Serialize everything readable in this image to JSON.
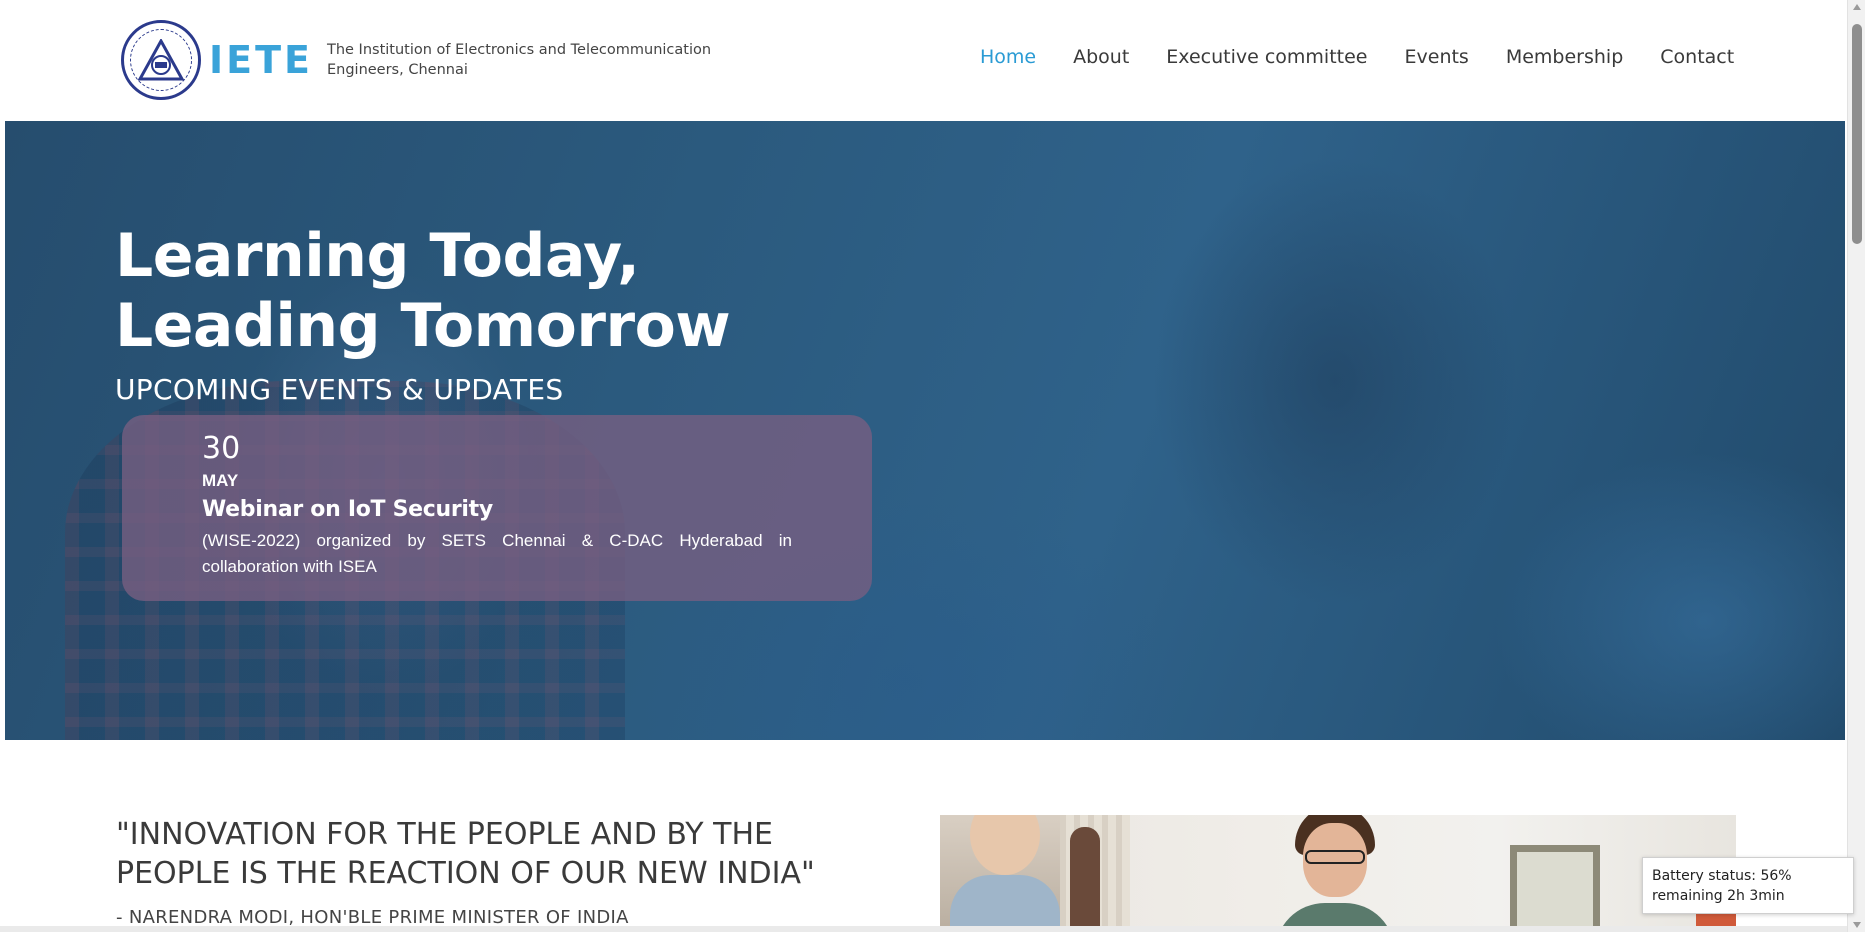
{
  "header": {
    "brand": "IETE",
    "tagline": "The Institution of Electronics and Telecommunication Engineers, Chennai",
    "accent_color": "#3aa3d9"
  },
  "nav": {
    "items": [
      {
        "label": "Home",
        "active": true
      },
      {
        "label": "About",
        "active": false
      },
      {
        "label": "Executive committee",
        "active": false
      },
      {
        "label": "Events",
        "active": false
      },
      {
        "label": "Membership",
        "active": false
      },
      {
        "label": "Contact",
        "active": false
      }
    ],
    "active_color": "#2a9bd4"
  },
  "hero": {
    "title_line1": "Learning Today,",
    "title_line2": "Leading Tomorrow",
    "subtitle": "UPCOMING EVENTS & UPDATES",
    "event": {
      "day": "30",
      "month": "MAY",
      "title": "Webinar on IoT Security",
      "description": "(WISE-2022) organized by SETS Chennai & C-DAC Hyderabad in collaboration with ISEA"
    }
  },
  "quote": {
    "text": "\"INNOVATION FOR THE PEOPLE AND BY THE PEOPLE IS THE REACTION OF OUR NEW INDIA\"",
    "author": "- NARENDRA MODI, HON'BLE PRIME MINISTER OF INDIA"
  },
  "tooltip": {
    "battery": "Battery status: 56% remaining 2h 3min"
  }
}
